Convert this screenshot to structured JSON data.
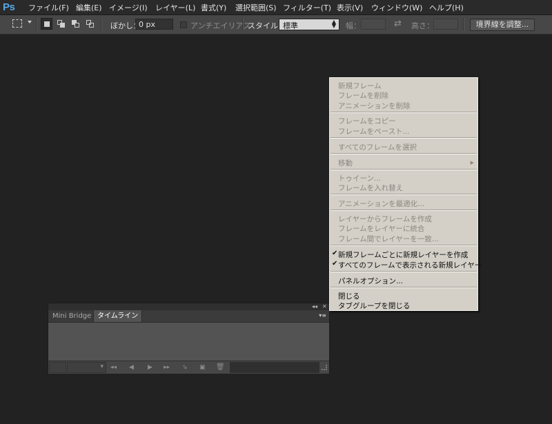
{
  "app": {
    "logo": "Ps"
  },
  "menubar": {
    "items": [
      {
        "label": "ファイル(F)"
      },
      {
        "label": "編集(E)"
      },
      {
        "label": "イメージ(I)"
      },
      {
        "label": "レイヤー(L)"
      },
      {
        "label": "書式(Y)"
      },
      {
        "label": "選択範囲(S)"
      },
      {
        "label": "フィルター(T)"
      },
      {
        "label": "表示(V)"
      },
      {
        "label": "ウィンドウ(W)"
      },
      {
        "label": "ヘルプ(H)"
      }
    ]
  },
  "options_bar": {
    "tool_icon": "rectangular-marquee-icon",
    "feather_label": "ぼかし：",
    "feather_value": "0 px",
    "antialias_label": "アンチエイリアス",
    "style_label": "スタイル：",
    "style_value": "標準",
    "width_label": "幅：",
    "width_value": "",
    "swap_icon": "swap-arrows-icon",
    "height_label": "高さ：",
    "height_value": "",
    "refine_edge_button": "境界線を調整..."
  },
  "context_menu": {
    "items": [
      {
        "label": "新規フレーム",
        "enabled": false
      },
      {
        "label": "フレームを削除",
        "enabled": false
      },
      {
        "label": "アニメーションを削除",
        "enabled": false
      },
      {
        "label": "フレームをコピー",
        "enabled": false
      },
      {
        "label": "フレームをペースト...",
        "enabled": false
      },
      {
        "label": "すべてのフレームを選択",
        "enabled": false
      },
      {
        "label": "移動",
        "enabled": false,
        "submenu": true
      },
      {
        "label": "トゥイーン...",
        "enabled": false
      },
      {
        "label": "フレームを入れ替え",
        "enabled": false
      },
      {
        "label": "アニメーションを最適化...",
        "enabled": false
      },
      {
        "label": "レイヤーからフレームを作成",
        "enabled": false
      },
      {
        "label": "フレームをレイヤーに統合",
        "enabled": false
      },
      {
        "label": "フレーム間でレイヤーを一致...",
        "enabled": false
      },
      {
        "label": "新規フレームごとに新規レイヤーを作成",
        "enabled": true,
        "checked": true
      },
      {
        "label": "すべてのフレームで表示される新規レイヤー",
        "enabled": true,
        "checked": true
      },
      {
        "label": "パネルオプション...",
        "enabled": true
      },
      {
        "label": "閉じる",
        "enabled": true
      },
      {
        "label": "タブグループを閉じる",
        "enabled": true
      }
    ],
    "check_glyph": "✔",
    "submenu_glyph": "▶"
  },
  "panel": {
    "collapse_glyph": "◂◂",
    "close_glyph": "✕",
    "menu_glyph": "▾≡",
    "tabs": [
      {
        "label": "Mini Bridge",
        "active": false
      },
      {
        "label": "タイムライン",
        "active": true
      }
    ],
    "footer_icons": [
      "dropdown-icon",
      "first-frame-icon",
      "previous-frame-icon",
      "play-icon",
      "next-frame-icon",
      "tween-icon",
      "new-frame-icon",
      "delete-frame-icon"
    ],
    "footer_glyphs": {
      "dropdown": "▾",
      "first": "◂◂",
      "prev": "◀",
      "play": "▶",
      "next": "▸▸",
      "tween": "⇘",
      "new": "▣",
      "delete": "🗑"
    }
  }
}
